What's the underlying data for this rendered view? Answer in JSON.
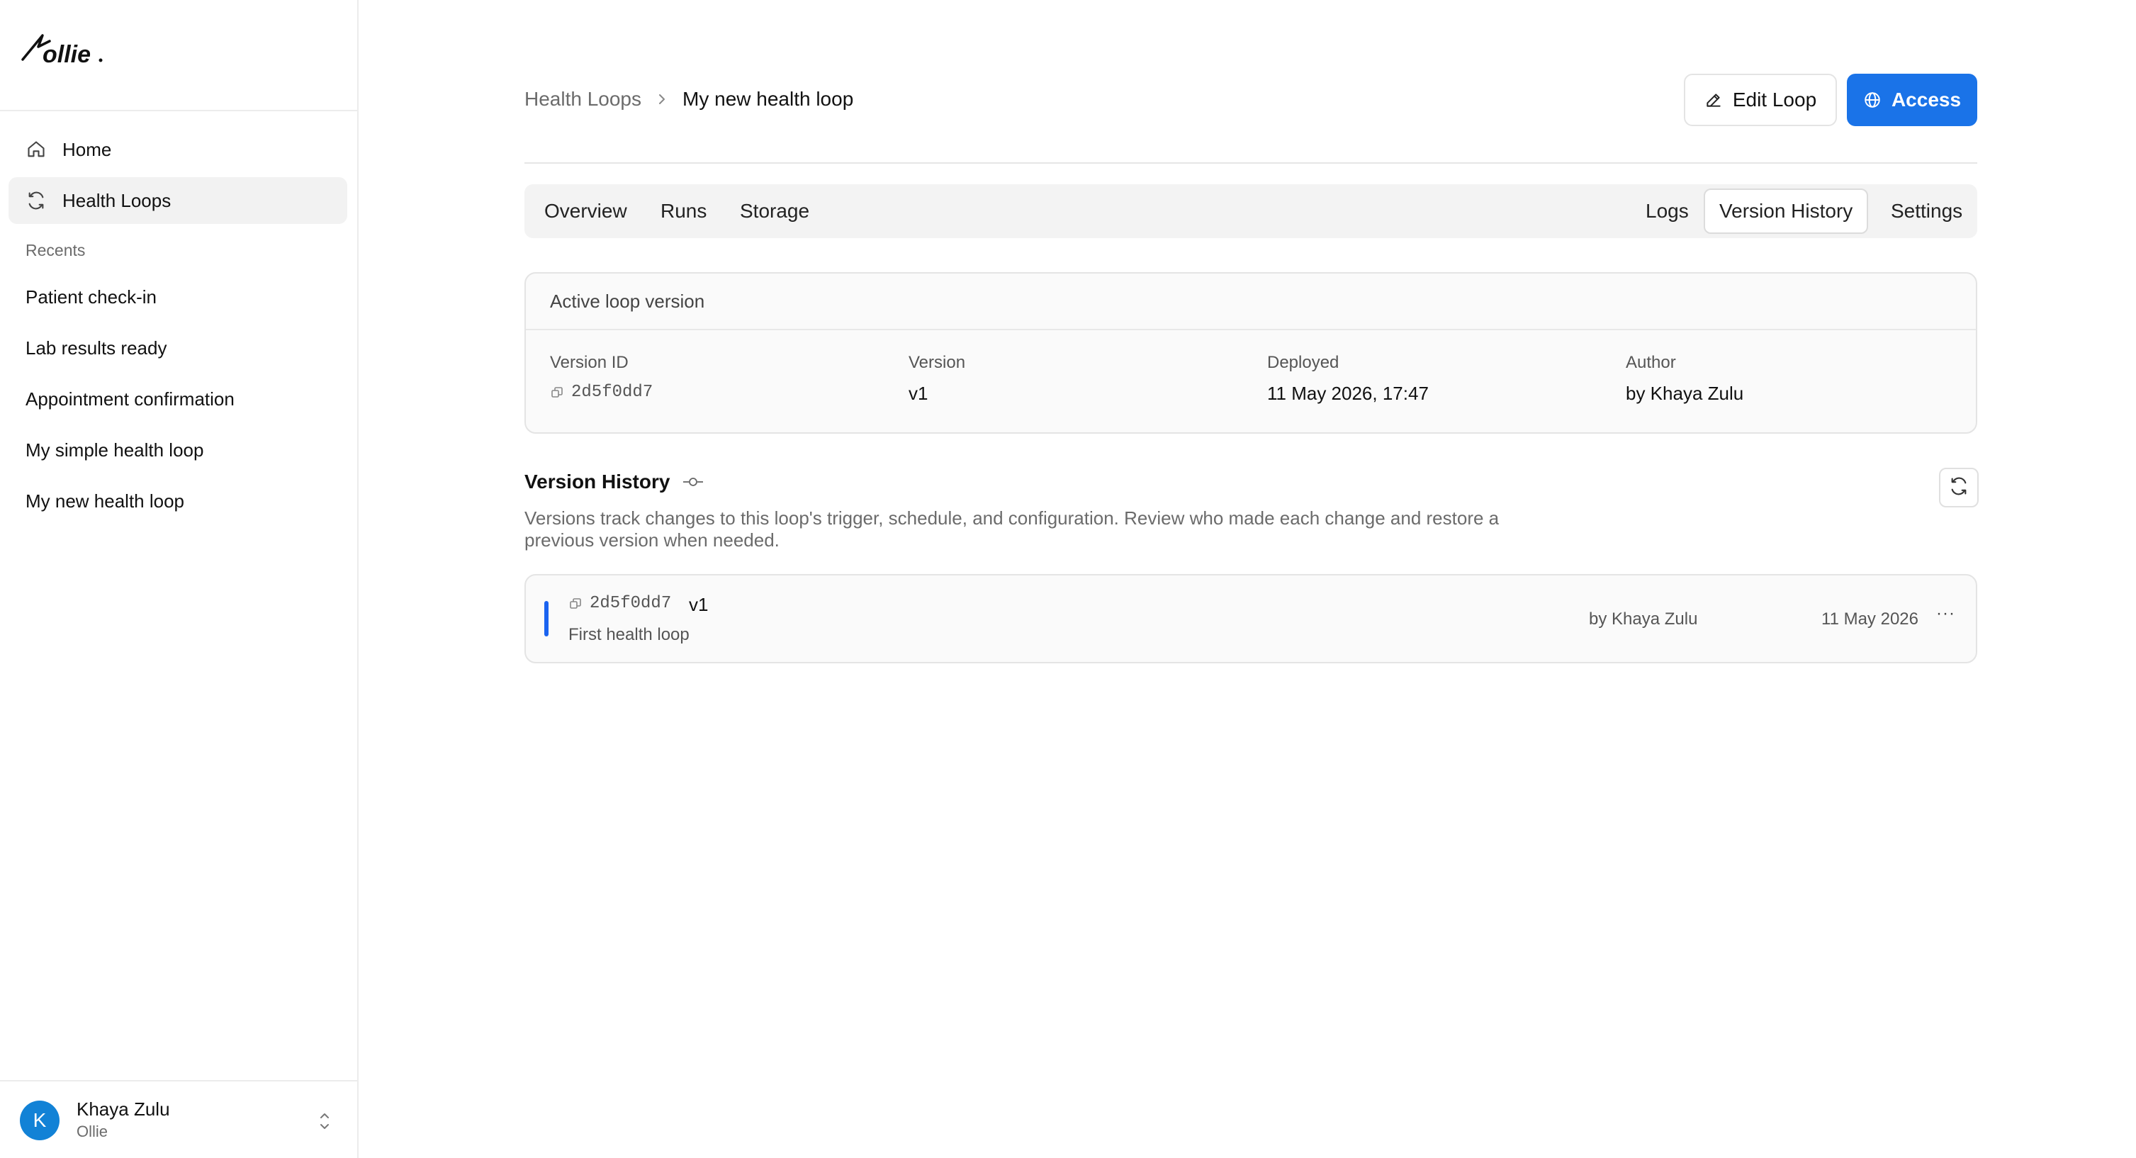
{
  "app": {
    "logo_text": "ollie"
  },
  "sidebar": {
    "nav": [
      {
        "label": "Home",
        "icon": "home-icon"
      },
      {
        "label": "Health Loops",
        "icon": "refresh-icon",
        "active": true
      }
    ],
    "recents_label": "Recents",
    "recents": [
      "Patient check-in",
      "Lab results ready",
      "Appointment confirmation",
      "My simple health loop",
      "My new health loop"
    ],
    "user": {
      "initial": "K",
      "name": "Khaya Zulu",
      "org": "Ollie"
    }
  },
  "header": {
    "breadcrumb_parent": "Health Loops",
    "breadcrumb_current": "My new health loop",
    "edit_label": "Edit Loop",
    "access_label": "Access"
  },
  "tabs": {
    "left": [
      "Overview",
      "Runs",
      "Storage"
    ],
    "right": [
      "Logs",
      "Version History",
      "Settings"
    ],
    "active": "Version History"
  },
  "active_version": {
    "title": "Active loop version",
    "fields": [
      {
        "label": "Version ID",
        "value": "2d5f0dd7"
      },
      {
        "label": "Version",
        "value": "v1"
      },
      {
        "label": "Deployed",
        "value": "11 May 2026, 17:47"
      },
      {
        "label": "Author",
        "value": "by Khaya Zulu"
      }
    ]
  },
  "version_history": {
    "title": "Version History",
    "description": "Versions track changes to this loop's trigger, schedule, and configuration. Review who made each change and restore a previous version when needed.",
    "rows": [
      {
        "id": "2d5f0dd7",
        "version": "v1",
        "message": "First health loop",
        "author": "by Khaya Zulu",
        "date": "11 May 2026",
        "menu": "···"
      }
    ]
  },
  "colors": {
    "accent": "#1a73e8",
    "active_bar": "#1a63f0",
    "avatar": "#1282d6"
  }
}
